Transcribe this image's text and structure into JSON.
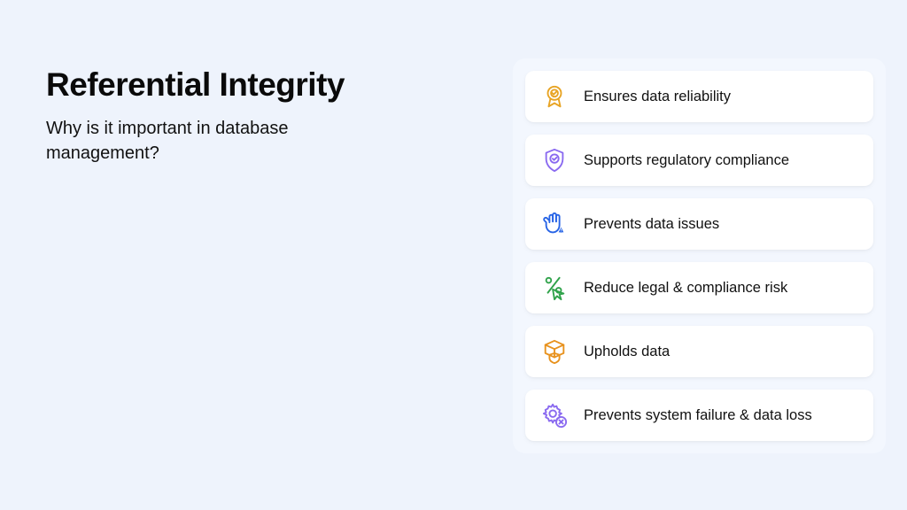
{
  "heading": {
    "title": "Referential Integrity",
    "subtitle": "Why is it important in database management?"
  },
  "cards": [
    {
      "label": "Ensures data reliability",
      "icon": "award-ribbon-icon",
      "color": "#e8a424"
    },
    {
      "label": "Supports regulatory compliance",
      "icon": "shield-check-icon",
      "color": "#8a6af0"
    },
    {
      "label": "Prevents data issues",
      "icon": "hand-alert-icon",
      "color": "#2764e6"
    },
    {
      "label": "Reduce legal & compliance risk",
      "icon": "cursor-percent-icon",
      "color": "#2fa24a"
    },
    {
      "label": "Upholds data",
      "icon": "box-shield-icon",
      "color": "#e8921e"
    },
    {
      "label": "Prevents system failure & data loss",
      "icon": "gear-x-icon",
      "color": "#8a6af0"
    }
  ]
}
